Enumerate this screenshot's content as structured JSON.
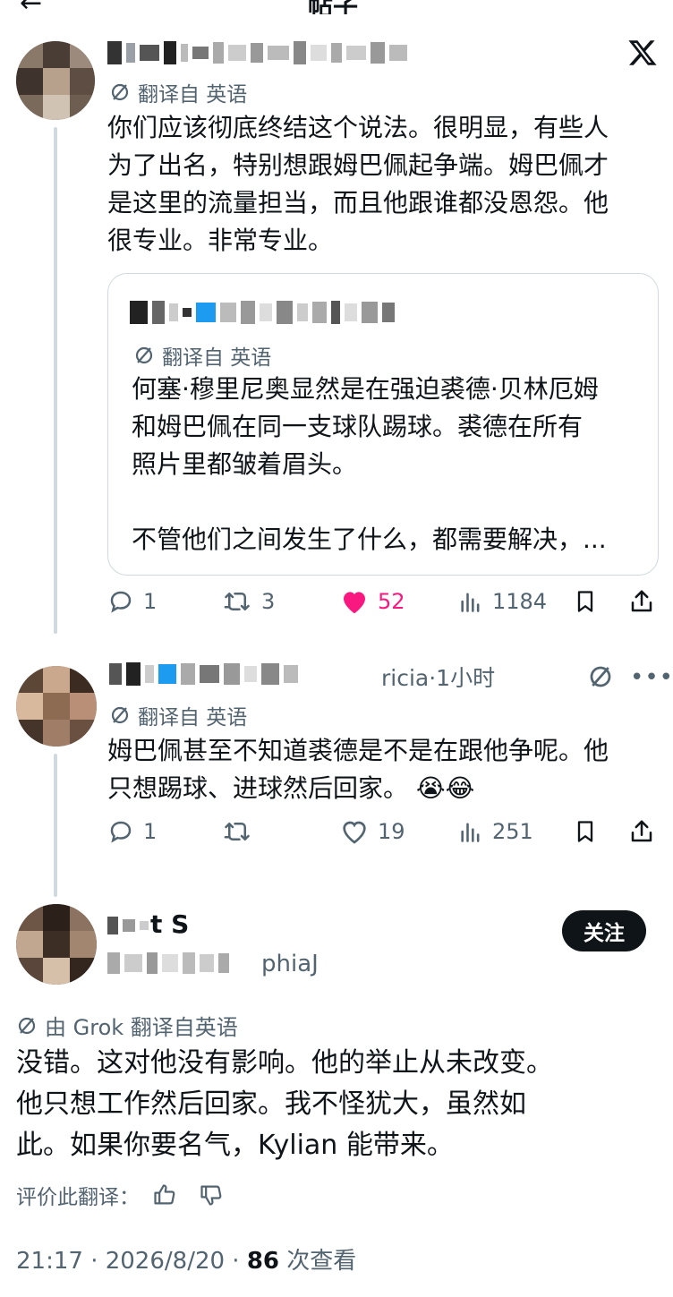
{
  "header": {
    "title": "帖子",
    "back_icon": "back-arrow-icon"
  },
  "x_logo": "x-logo-icon",
  "tweet1": {
    "translate_label": "翻译自 英语",
    "lines": [
      "你们应该彻底终结这个说法。很明显，有些人",
      "为了出名，特别想跟姆巴佩起争端。姆巴佩才",
      "是这里的流量担当，而且他跟谁都没恩怨。他",
      "很专业。非常专业。"
    ],
    "quote": {
      "translate_label": "翻译自 英语",
      "lines": [
        "何塞·穆里尼奥显然是在强迫裘德·贝林厄姆",
        "和姆巴佩在同一支球队踢球。裘德在所有",
        "照片里都皱着眉头。",
        "",
        "不管他们之间发生了什么，都需要解决，..."
      ]
    },
    "stats": {
      "replies": "1",
      "retweets": "3",
      "likes": "52",
      "views": "1184"
    }
  },
  "tweet2": {
    "name_tail": "ricia·1小时",
    "translate_label": "翻译自 英语",
    "lines": [
      "姆巴佩甚至不知道裘德是不是在跟他争呢。他",
      "只想踢球、进球然后回家。"
    ],
    "emoji": "😭😂",
    "stats": {
      "replies": "1",
      "retweets": "",
      "likes": "19",
      "views": "251"
    }
  },
  "tweet3": {
    "name_tail": "t S",
    "handle_tail": "phiaJ",
    "follow_label": "关注",
    "translate_label": "由 Grok 翻译自英语",
    "lines": [
      "没错。这对他没有影响。他的举止从未改变。",
      "他只想工作然后回家。我不怪犹大，虽然如",
      "此。如果你要名气，Kylian 能带来。"
    ],
    "rate_label": "评价此翻译："
  },
  "meta": {
    "time": "21:17 · 2026/8/20 · ",
    "views": "86",
    "views_suffix": " 次查看"
  },
  "colors": {
    "like_pink": "#f91880",
    "secondary": "#536471",
    "border": "#cfd9de",
    "text": "#0f1419"
  }
}
